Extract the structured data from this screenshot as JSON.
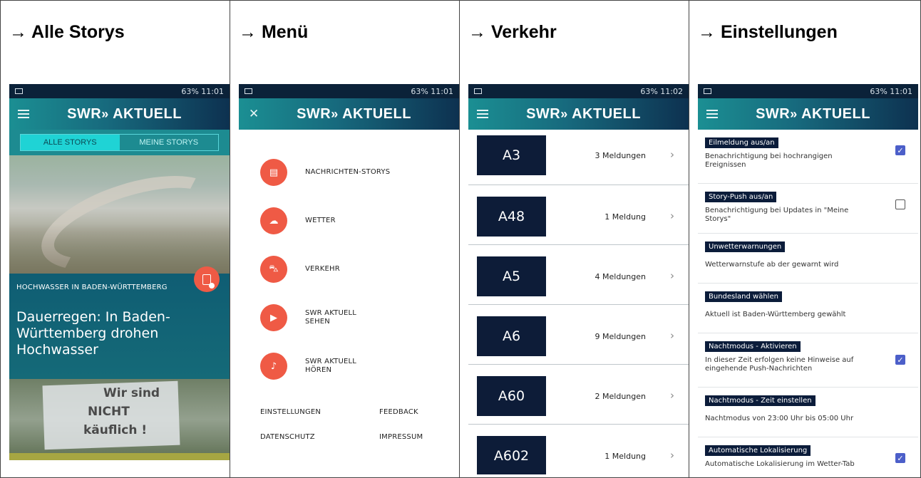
{
  "columns": [
    {
      "title": "→ Alle Storys"
    },
    {
      "title": "→ Menü"
    },
    {
      "title": "→ Verkehr"
    },
    {
      "title": "→ Einstellungen"
    }
  ],
  "status": {
    "p1": "63% 11:01",
    "p2": "63% 11:01",
    "p3": "63% 11:02",
    "p4": "63% 11:01"
  },
  "app": {
    "logo_text": "SWR",
    "logo_arrow": "»",
    "logo_word": "AKTUELL"
  },
  "stories": {
    "tabs": [
      "ALLE STORYS",
      "MEINE STORYS"
    ],
    "kicker": "HOCHWASSER IN BADEN-WÜRTTEMBERG",
    "headline": "Dauerregen: In Baden-Württemberg drohen Hochwasser",
    "sign_lines": [
      "Wir sind",
      "NICHT",
      "käuflich !"
    ]
  },
  "menu": {
    "items": [
      {
        "label": "NACHRICHTEN-STORYS",
        "icon": "document-icon",
        "glyph": "▤"
      },
      {
        "label": "WETTER",
        "icon": "weather-icon",
        "glyph": "☁"
      },
      {
        "label": "VERKEHR",
        "icon": "car-icon",
        "glyph": "⛍"
      },
      {
        "label": "SWR AKTUELL\nSEHEN",
        "icon": "video-icon",
        "glyph": "▶"
      },
      {
        "label": "SWR AKTUELL\nHÖREN",
        "icon": "audio-icon",
        "glyph": "♪"
      }
    ],
    "footer": [
      "EINSTELLUNGEN",
      "FEEDBACK",
      "DATENSCHUTZ",
      "IMPRESSUM"
    ]
  },
  "traffic": {
    "rows": [
      {
        "road": "A3",
        "count": "3 Meldungen"
      },
      {
        "road": "A48",
        "count": "1 Meldung"
      },
      {
        "road": "A5",
        "count": "4 Meldungen"
      },
      {
        "road": "A6",
        "count": "9 Meldungen"
      },
      {
        "road": "A60",
        "count": "2 Meldungen"
      },
      {
        "road": "A602",
        "count": "1 Meldung"
      }
    ],
    "chevron": "›"
  },
  "settings": {
    "items": [
      {
        "title": "Eilmeldung aus/an",
        "desc": "Benachrichtigung bei hochrangigen Ereignissen",
        "checkbox": "checked"
      },
      {
        "title": "Story-Push aus/an",
        "desc": "Benachrichtigung bei Updates in \"Meine Storys\"",
        "checkbox": "unchecked"
      },
      {
        "title": "Unwetterwarnungen",
        "desc": "Wetterwarnstufe ab der gewarnt wird",
        "checkbox": "none"
      },
      {
        "title": "Bundesland wählen",
        "desc": "Aktuell ist Baden-Württemberg gewählt",
        "checkbox": "none"
      },
      {
        "title": "Nachtmodus - Aktivieren",
        "desc": "In dieser Zeit erfolgen keine Hinweise auf eingehende Push-Nachrichten",
        "checkbox": "checked"
      },
      {
        "title": "Nachtmodus - Zeit einstellen",
        "desc": "Nachtmodus von 23:00 Uhr bis 05:00 Uhr",
        "checkbox": "none"
      },
      {
        "title": "Automatische Lokalisierung",
        "desc": "Automatische Lokalisierung im Wetter-Tab",
        "checkbox": "checked"
      }
    ]
  },
  "colors": {
    "accent_red": "#ef5a45",
    "navy": "#0d1c38",
    "teal": "#1d8b91",
    "checkbox_blue": "#4c5fc9"
  }
}
